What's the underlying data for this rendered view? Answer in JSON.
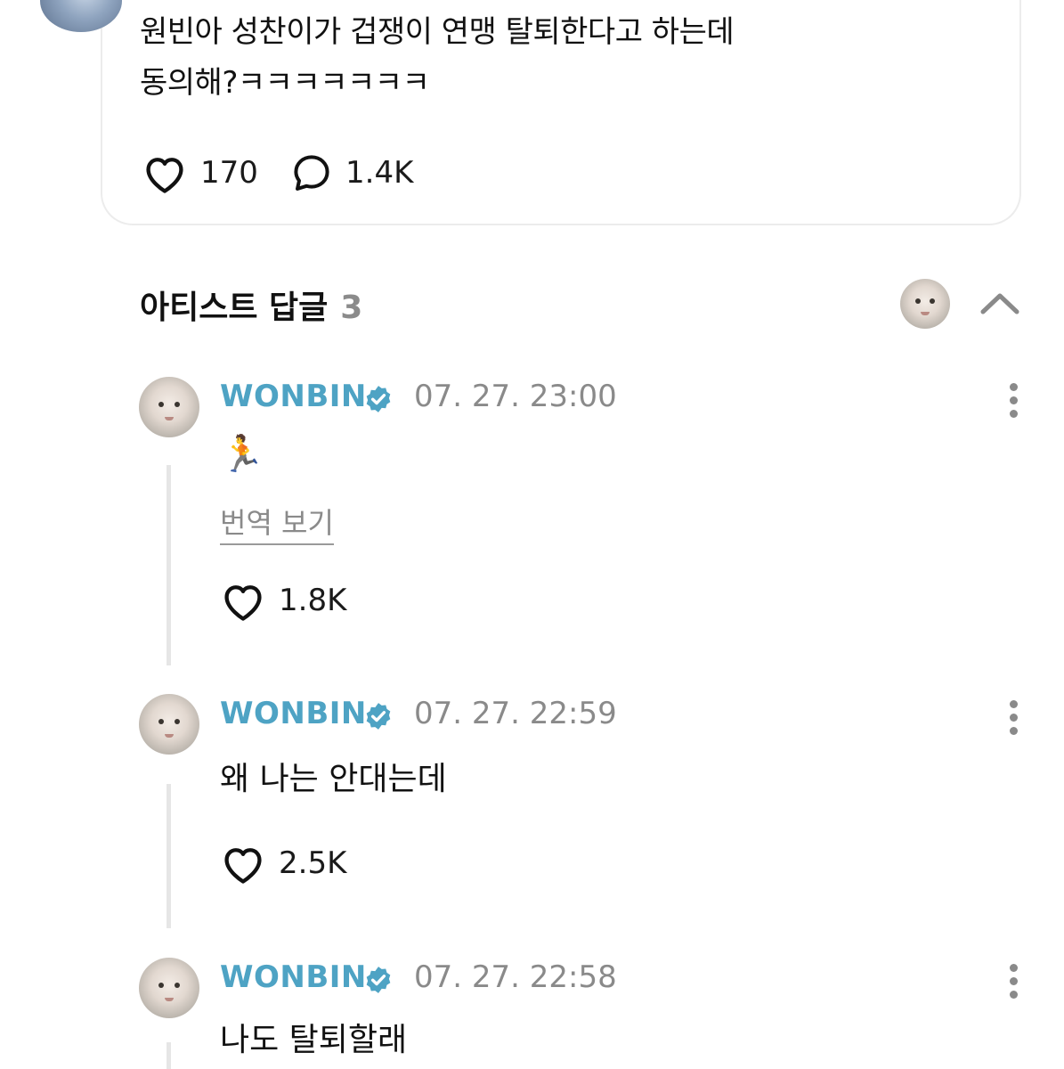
{
  "post": {
    "line1": "원빈아 성찬이가 겁쟁이 연맹 탈퇴한다고 하는데",
    "line2": "동의해?ㅋㅋㅋㅋㅋㅋㅋ",
    "likes": "170",
    "comments": "1.4K"
  },
  "artist_replies": {
    "title": "아티스트 답글",
    "count": "3"
  },
  "replies": [
    {
      "name": "WONBIN",
      "time": "07. 27. 23:00",
      "body": "🏃",
      "translate": "번역 보기",
      "likes": "1.8K"
    },
    {
      "name": "WONBIN",
      "time": "07. 27. 22:59",
      "body": "왜 나는 안대는데",
      "likes": "2.5K"
    },
    {
      "name": "WONBIN",
      "time": "07. 27. 22:58",
      "body": "나도 탈퇴할래"
    }
  ],
  "colors": {
    "name": "#4ea3c4",
    "muted": "#8a8a8a",
    "line": "#e6e6e6"
  },
  "icons": [
    "heart-icon",
    "comment-icon",
    "verified-badge-icon",
    "more-options-icon",
    "collapse-chevron-icon"
  ]
}
